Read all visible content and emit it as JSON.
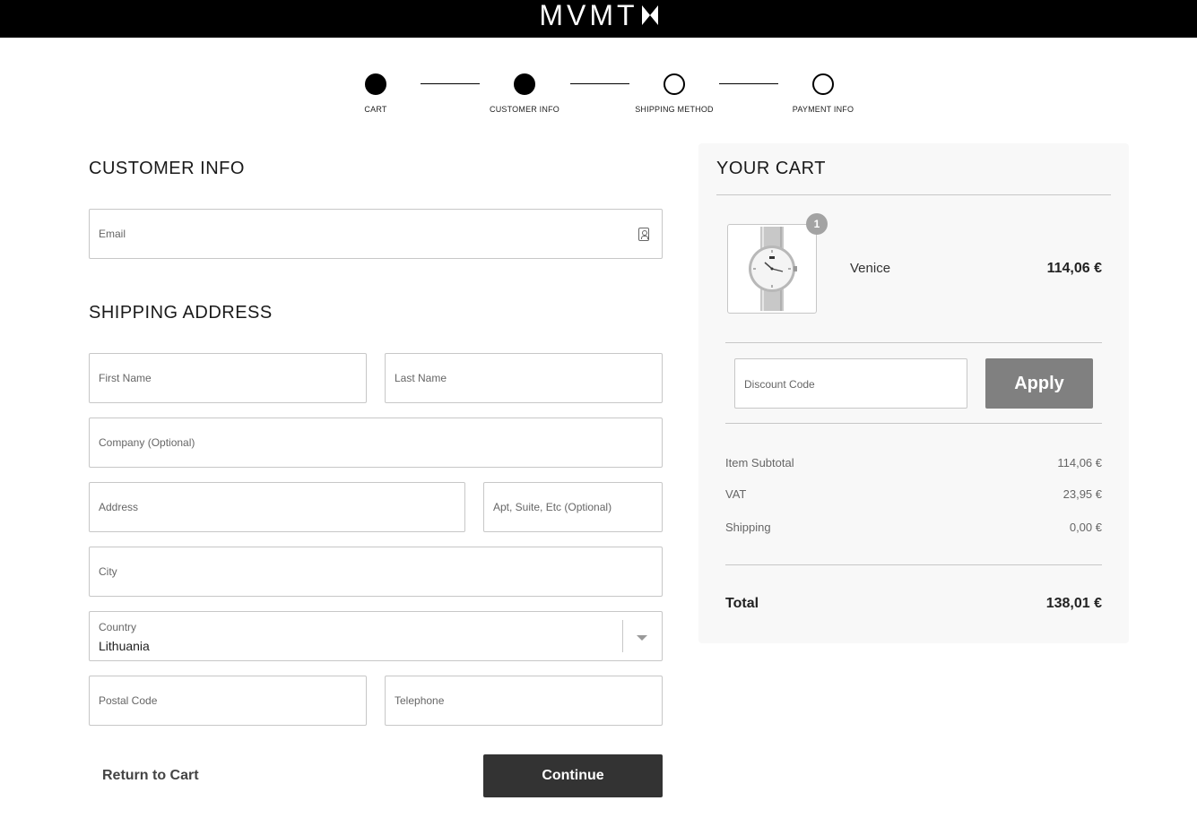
{
  "header": {
    "logo_text": "MVMT"
  },
  "steps": [
    {
      "label": "CART",
      "state": "complete"
    },
    {
      "label": "CUSTOMER INFO",
      "state": "current"
    },
    {
      "label": "SHIPPING METHOD",
      "state": "pending"
    },
    {
      "label": "PAYMENT INFO",
      "state": "pending"
    }
  ],
  "customer_info": {
    "title": "CUSTOMER INFO",
    "email": {
      "placeholder": "Email",
      "icon": "contact-card-icon"
    }
  },
  "shipping": {
    "title": "SHIPPING ADDRESS",
    "first_name": {
      "placeholder": "First Name"
    },
    "last_name": {
      "placeholder": "Last Name"
    },
    "company": {
      "placeholder": "Company (Optional)"
    },
    "address": {
      "placeholder": "Address"
    },
    "apt": {
      "placeholder": "Apt, Suite, Etc (Optional)"
    },
    "city": {
      "placeholder": "City"
    },
    "country": {
      "label": "Country",
      "value": "Lithuania"
    },
    "postal": {
      "placeholder": "Postal Code"
    },
    "telephone": {
      "placeholder": "Telephone"
    }
  },
  "actions": {
    "return_label": "Return to Cart",
    "continue_label": "Continue"
  },
  "cart": {
    "title": "YOUR CART",
    "item": {
      "name": "Venice",
      "price": "114,06 €",
      "quantity": "1",
      "image_icon": "watch-icon"
    },
    "discount": {
      "placeholder": "Discount Code",
      "apply_label": "Apply"
    },
    "summary": [
      {
        "label": "Item Subtotal",
        "value": "114,06 €"
      },
      {
        "label": "VAT",
        "value": "23,95 €"
      },
      {
        "label": "Shipping",
        "value": "0,00 €"
      }
    ],
    "total": {
      "label": "Total",
      "value": "138,01 €"
    }
  }
}
